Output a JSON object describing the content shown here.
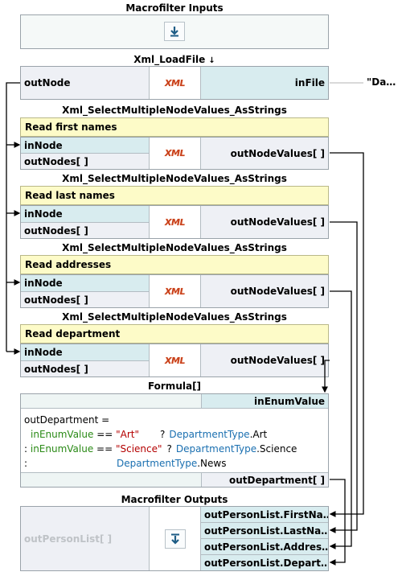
{
  "inputs": {
    "title": "Macrofilter Inputs",
    "icon": "download-arrow-icon"
  },
  "loadfile": {
    "title": "Xml_LoadFile",
    "title_arrow": "🠗",
    "out": "outNode",
    "in": "inFile",
    "value": "\"Da…",
    "icon": "XML"
  },
  "select_title": "Xml_SelectMultipleNodeValues_AsStrings",
  "select_blocks": [
    {
      "label": "Read first names",
      "in": "inNode",
      "nodes": "outNodes[ ]",
      "out": "outNodeValues[ ]",
      "icon": "XML"
    },
    {
      "label": "Read last names",
      "in": "inNode",
      "nodes": "outNodes[ ]",
      "out": "outNodeValues[ ]",
      "icon": "XML"
    },
    {
      "label": "Read addresses",
      "in": "inNode",
      "nodes": "outNodes[ ]",
      "out": "outNodeValues[ ]",
      "icon": "XML"
    },
    {
      "label": "Read department",
      "in": "inNode",
      "nodes": "outNodes[ ]",
      "out": "outNodeValues[ ]",
      "icon": "XML"
    }
  ],
  "formula": {
    "title": "Formula[]",
    "input": "inEnumValue",
    "output": "outDepartment[ ]",
    "line1": "outDepartment =",
    "l2_var": "inEnumValue",
    "l2_op": " == ",
    "l2_str": "\"Art\"",
    "l2_q": "?",
    "l2_type": "DepartmentType",
    "l2_member": ".Art",
    "l3_prefix": ": ",
    "l3_var": "inEnumValue",
    "l3_op": " == ",
    "l3_str": "\"Science\"",
    "l3_q": "?",
    "l3_type": "DepartmentType",
    "l3_member": ".Science",
    "l4_prefix": ":",
    "l4_type": "DepartmentType",
    "l4_member": ".News"
  },
  "outputs": {
    "title": "Macrofilter Outputs",
    "list": "outPersonList[ ]",
    "items": [
      "outPersonList.FirstNa…",
      "outPersonList.LastNa…",
      "outPersonList.Addres…",
      "outPersonList.Depart…"
    ],
    "icon": "upload-arrow-icon"
  },
  "colors": {
    "input_port": "#d8ecef",
    "output_port": "#eef0f5",
    "comment": "#fdfbc8",
    "xml_icon": "#c8401b",
    "string_literal": "#b40000",
    "variable": "#2a8a16",
    "type": "#1a6fb0"
  }
}
